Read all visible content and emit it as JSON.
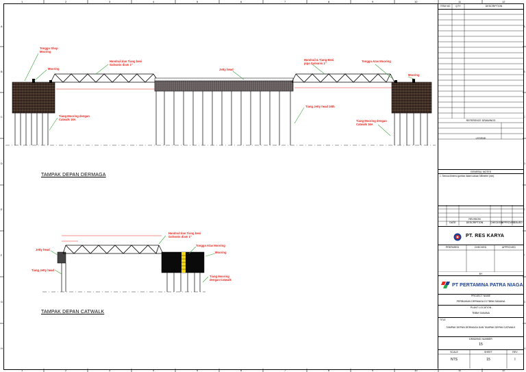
{
  "grid": {
    "columns": [
      "1",
      "2",
      "3",
      "4",
      "5",
      "6",
      "7",
      "8",
      "9",
      "10",
      "11",
      "12"
    ],
    "rows": [
      "A",
      "B",
      "C",
      "D",
      "E",
      "F",
      "G",
      "H"
    ]
  },
  "views": {
    "front_pier_title": "TAMPAK DEPAN DERMAGA",
    "front_catwalk_title": "TAMPAK DEPAN CATWALK"
  },
  "callouts_pier": {
    "bollard": "Tonggo Shop",
    "bollard_2": "Mooring",
    "mooring_left": "Mooring",
    "handrail_left_1": "Handrail dan Tiang besi",
    "handrail_left_2": "Galvanis diam 1\"",
    "jetty_head": "Jetty head",
    "handrail_right_1": "Handrail & Tiang Besi",
    "handrail_right_2": "pipa Galvanis 1\"",
    "bollard_right": "Tonggo Atas Mooring",
    "mooring_right": "Mooring",
    "pile_left_1": "Tiang Mooring dengan",
    "pile_left_2": "Catwalk 16A",
    "pile_jetty": "Tiang Jetty head 16th",
    "pile_right_1": "Tiang Mooring dengan",
    "pile_right_2": "Catwalk 16A"
  },
  "callouts_catwalk": {
    "handrail_1": "Handrail dan Tiang besi",
    "handrail_2": "Galvanis diam 1\"",
    "jetty_head": "Jetty head",
    "pile_jetty": "Tiang Jetty head",
    "bollard": "Tonggo Atas Mooring",
    "mooring": "Mooring",
    "pile_mooring_1": "Tiang Mooring",
    "pile_mooring_2": "dengan Catwalk"
  },
  "title_block": {
    "rev_header": {
      "item_no": "ITEM NO",
      "qty": "QTY",
      "description": "DESCRIPTION"
    },
    "reference_drawings": "REFERENCE DRAWINGS",
    "legend": "LEGEND",
    "general_notes": "GENERAL NOTES",
    "note_1": "1. Semua dimensi gambar dalam satuan Milimeter (mm)",
    "revision_header": "REVISION",
    "revision_cols": [
      "DATE",
      "DESCRIPTION",
      "CHECKED",
      "APPROVED",
      "ISSUED"
    ],
    "contractor": "PT. RES KARYA",
    "sign_cols": [
      "PREPARED",
      "CHECKED",
      "APPROVED"
    ],
    "by_label": "BY",
    "owner": "PT PERTAMINA PATRA NIAGA",
    "project_name_label": "PROJECT NAME",
    "project_name": "PERBAIKAN DERMAGA DI TBBM SANANA",
    "plant_location_label": "PLANT LOCATION",
    "plant_location": "TBBM SANANA",
    "title_label": "TITLE",
    "title_text": "TAMPAK DEPAN DERMAGA DAN TAMPAK DEPAN CATWALK",
    "drawing_number_label": "DRAWING NUMBER",
    "drawing_number": "15",
    "scale_label": "SCALE",
    "sheet_label": "SHEET",
    "rev_label": "REV",
    "scale": "NTS",
    "sheet": "15",
    "rev": "I"
  },
  "colors": {
    "callout": "#e8261c",
    "line": "#000000",
    "highlight": "#f2d91a"
  }
}
